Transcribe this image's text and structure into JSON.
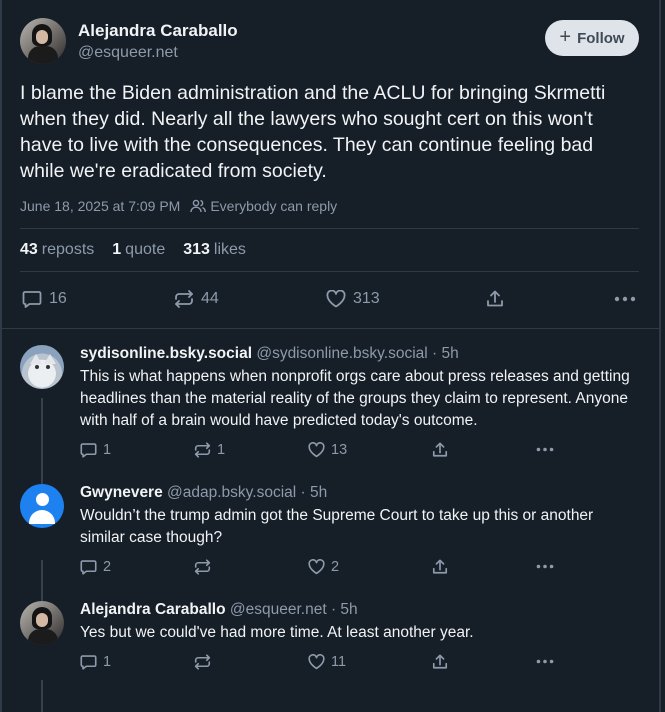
{
  "post": {
    "author": {
      "display_name": "Alejandra Caraballo",
      "handle": "@esqueer.net"
    },
    "follow_label": "Follow",
    "text": "I blame the Biden administration and the ACLU for bringing Skrmetti when they did. Nearly all the lawyers who sought cert on this won't have to live with the consequences. They can continue feeling bad while we're eradicated from society.",
    "timestamp": "June 18, 2025 at 7:09 PM",
    "reply_setting": "Everybody can reply",
    "stats": {
      "reposts_count": "43",
      "reposts_label": "reposts",
      "quotes_count": "1",
      "quotes_label": "quote",
      "likes_count": "313",
      "likes_label": "likes"
    },
    "actions": {
      "replies": "16",
      "reposts": "44",
      "likes": "313"
    }
  },
  "replies": [
    {
      "display_name": "sydisonline.bsky.social",
      "handle": "@sydisonline.bsky.social",
      "age": "· 5h",
      "text": "This is what happens when nonprofit orgs care about press releases and getting headlines than the material reality of the groups they claim to represent. Anyone with half of a brain would have predicted today's outcome.",
      "replies": "1",
      "reposts": "1",
      "likes": "13"
    },
    {
      "display_name": "Gwynevere",
      "handle": "@adap.bsky.social",
      "age": "· 5h",
      "text": "Wouldn’t the trump admin got the Supreme Court to take up this or another similar case though?",
      "replies": "2",
      "reposts": "",
      "likes": "2"
    },
    {
      "display_name": "Alejandra Caraballo",
      "handle": "@esqueer.net",
      "age": "· 5h",
      "text": "Yes but we could've had more time. At least another year.",
      "replies": "1",
      "reposts": "",
      "likes": "11"
    }
  ],
  "icons": {
    "follow": "plus-icon",
    "reply_setting": "people-icon",
    "reply": "speech-bubble-icon",
    "repost": "repost-arrows-icon",
    "like": "heart-icon",
    "share": "share-upload-icon",
    "more": "ellipsis-icon"
  },
  "colors": {
    "background": "#161e27",
    "text": "#f1f3f5",
    "muted": "#8c9aab",
    "border": "#2e3a48",
    "follow_bg": "#dfe4ea",
    "avatar_blue": "#1d82f0"
  }
}
